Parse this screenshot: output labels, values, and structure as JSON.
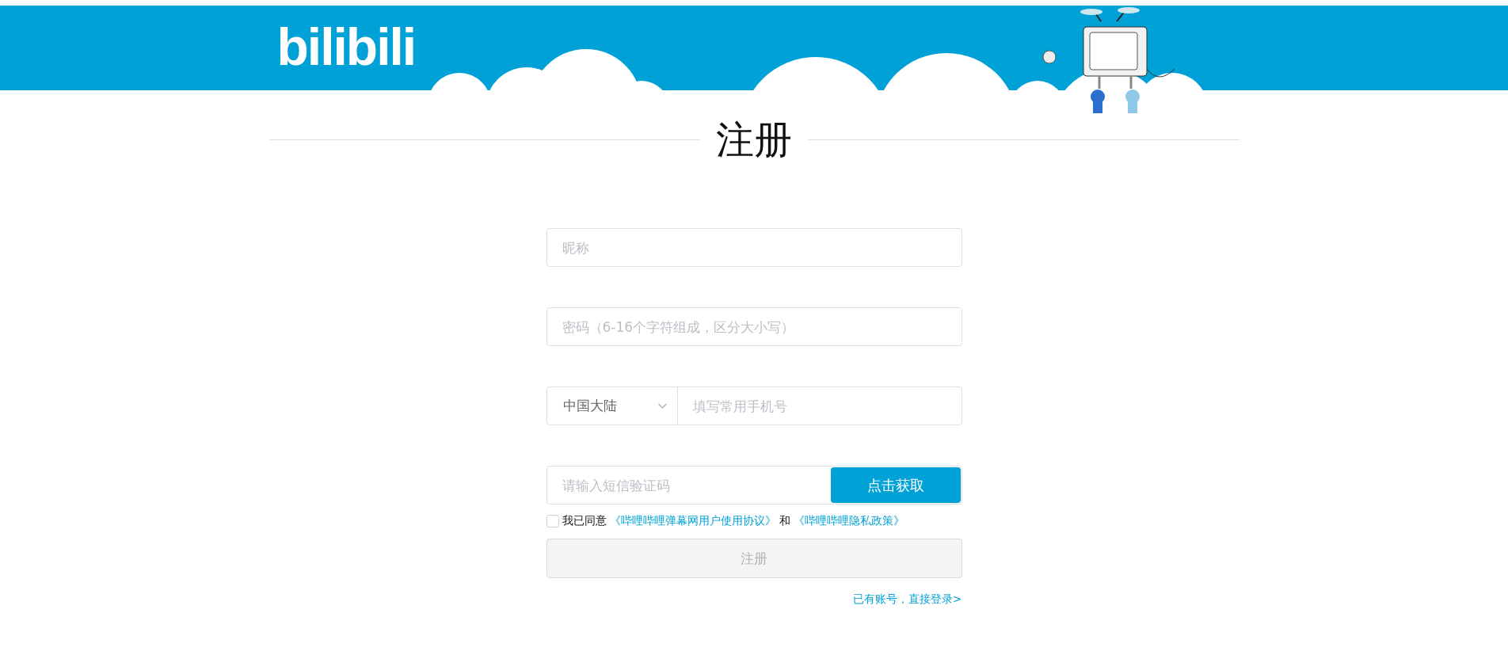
{
  "header": {
    "logo": "bilibili"
  },
  "title": "注册",
  "form": {
    "nickname": {
      "placeholder": "昵称"
    },
    "password": {
      "placeholder": "密码（6-16个字符组成，区分大小写）"
    },
    "phone": {
      "region": "中国大陆",
      "placeholder": "填写常用手机号"
    },
    "sms": {
      "placeholder": "请输入短信验证码",
      "button": "点击获取"
    },
    "agreement": {
      "checked": false,
      "text": "我已同意",
      "link_1": "《哔哩哔哩弹幕网用户使用协议》",
      "joiner": "和",
      "link_2": "《哔哩哔哩隐私政策》"
    },
    "submit": {
      "label": "注册",
      "disabled": true
    },
    "login_link": "已有账号，直接登录>"
  }
}
